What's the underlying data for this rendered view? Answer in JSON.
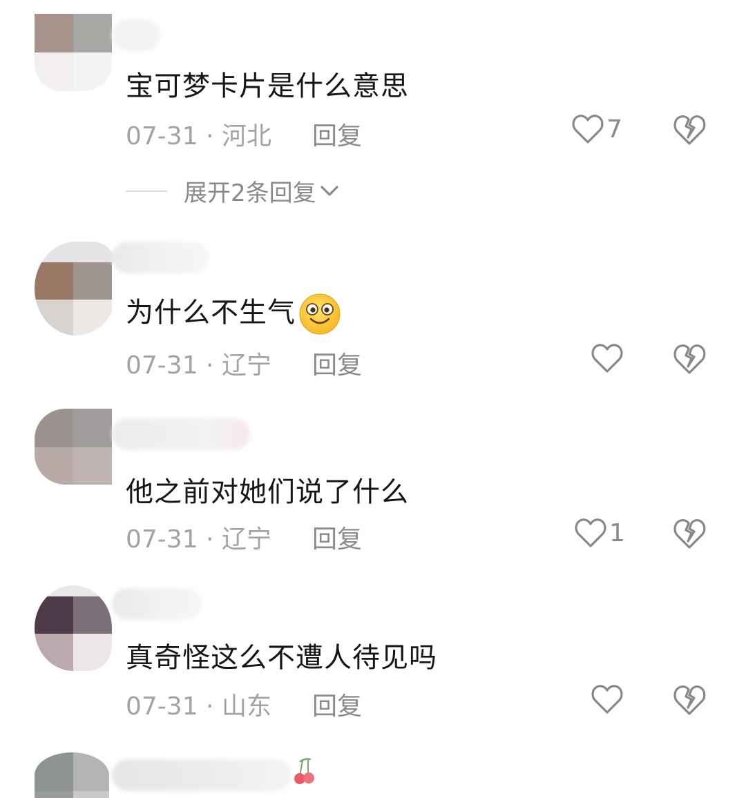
{
  "comments": [
    {
      "text": "宝可梦卡片是什么意思",
      "date": "07-31",
      "location": "河北",
      "reply_label": "回复",
      "likes": "7",
      "expand_label": "展开2条回复"
    },
    {
      "text": "为什么不生气",
      "emoji": "smile-emoji-icon",
      "date": "07-31",
      "location": "辽宁",
      "reply_label": "回复",
      "likes": ""
    },
    {
      "text": "他之前对她们说了什么",
      "date": "07-31",
      "location": "辽宁",
      "reply_label": "回复",
      "likes": "1"
    },
    {
      "text": "真奇怪这么不遭人待见吗",
      "date": "07-31",
      "location": "山东",
      "reply_label": "回复",
      "likes": ""
    }
  ],
  "icons": {
    "like": "heart-outline-icon",
    "dislike": "broken-heart-icon",
    "expand": "chevron-down-icon"
  },
  "colors": {
    "text": "#161616",
    "meta": "#a3a3a3",
    "secondary": "#8a8a8a"
  }
}
